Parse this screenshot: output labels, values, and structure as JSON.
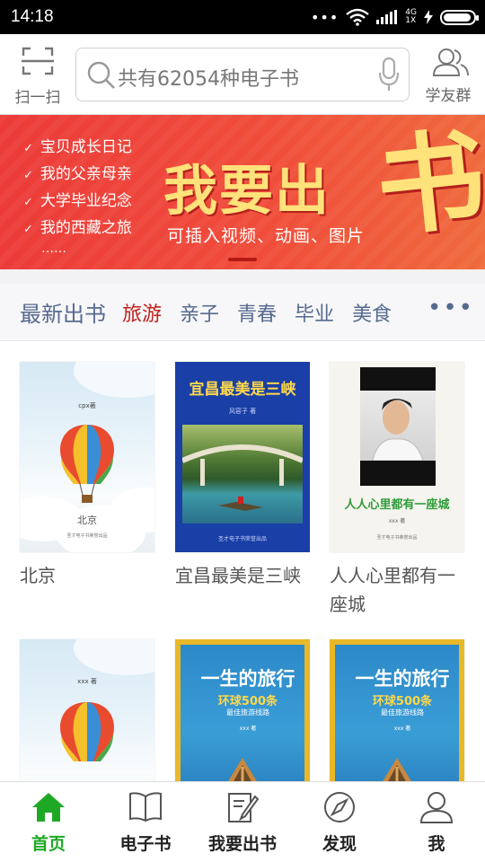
{
  "status_bar": {
    "time": "14:18",
    "network_type": "4G",
    "network_sub": "1X",
    "battery_level": 0.95
  },
  "header": {
    "scan_label": "扫一扫",
    "search_placeholder": "共有62054种电子书",
    "group_label": "学友群"
  },
  "banner": {
    "list": [
      "宝贝成长日记",
      "我的父亲母亲",
      "大学毕业纪念",
      "我的西藏之旅"
    ],
    "list_more": "……",
    "title": "我要出",
    "title_big": "书",
    "subtitle": "可插入视频、动画、图片"
  },
  "categories": {
    "main": "最新出书",
    "tabs": [
      "旅游",
      "亲子",
      "青春",
      "毕业",
      "美食"
    ],
    "active_index": 0,
    "more": "•••"
  },
  "books": [
    {
      "title": "北京",
      "cover": {
        "author": "cpx著",
        "name": "北京",
        "publisher": "圣才电子书荣誉出品"
      }
    },
    {
      "title": "宜昌最美是三峡",
      "cover": {
        "title": "宜昌最美是三峡",
        "author": "风容子 著",
        "publisher": "圣才电子书荣誉出品"
      }
    },
    {
      "title": "人人心里都有一座城",
      "cover": {
        "title": "人人心里都有一座城",
        "author": "xxx 著",
        "publisher": "圣才电子书荣誉出品"
      }
    },
    {
      "title": "",
      "cover": {
        "author": "xxx 著"
      }
    },
    {
      "title": "",
      "cover": {
        "title": "一生的旅行",
        "sub": "环球500条",
        "sub2": "最佳旅游线路",
        "author": "xxx 著"
      }
    },
    {
      "title": "",
      "cover": {
        "title": "一生的旅行",
        "sub": "环球500条",
        "sub2": "最佳旅游线路",
        "author": "xxx 著"
      }
    }
  ],
  "nav": [
    {
      "label": "首页",
      "icon": "home-icon"
    },
    {
      "label": "电子书",
      "icon": "book-icon"
    },
    {
      "label": "我要出书",
      "icon": "write-icon"
    },
    {
      "label": "发现",
      "icon": "compass-icon"
    },
    {
      "label": "我",
      "icon": "user-icon"
    }
  ],
  "colors": {
    "accent_green": "#1fa824",
    "tab_active": "#c0201b",
    "tab_text": "#566a8e",
    "banner_red": "#ec3b39",
    "banner_yellow": "#ffe27a"
  }
}
